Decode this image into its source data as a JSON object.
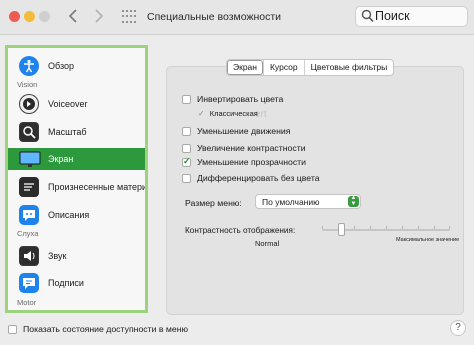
{
  "window": {
    "title": "Специальные возможности"
  },
  "search": {
    "placeholder": "Поиск"
  },
  "sidebar": {
    "items": [
      {
        "label": "Обзор",
        "icon": "overview-icon"
      },
      {
        "label": "Voiceover",
        "icon": "voiceover-icon"
      },
      {
        "label": "Масштаб",
        "icon": "zoom-icon"
      },
      {
        "label": "Экран",
        "icon": "display-icon",
        "active": true
      },
      {
        "label": "Произнесенные материалы",
        "icon": "spoken-content-icon"
      },
      {
        "label": "Описания",
        "icon": "descriptions-icon"
      },
      {
        "label": "Звук",
        "icon": "audio-icon"
      },
      {
        "label": "Подписи",
        "icon": "captions-icon"
      }
    ],
    "sections": {
      "vision": "Vision",
      "hearing": "Слуха",
      "motor": "Motor"
    },
    "active_color": "#2c9a3c",
    "border_color": "#9dd37a"
  },
  "tabs": [
    {
      "label": "Экран",
      "active": true
    },
    {
      "label": "Курсор",
      "active": false
    },
    {
      "label": "Цветовые фильтры",
      "active": false
    }
  ],
  "options": {
    "invert": {
      "label": "Инвертировать цвета",
      "checked": false
    },
    "classic": {
      "label": "Классическая",
      "ghost": "ert"
    },
    "reduce_motion": {
      "label": "Уменьшение движения",
      "checked": false
    },
    "increase_contrast": {
      "label": "Увеличение контрастности",
      "checked": false
    },
    "reduce_transparency": {
      "label": "Уменьшение прозрачности",
      "checked": true
    },
    "differentiate": {
      "label": "Дифференцировать без цвета",
      "checked": false
    }
  },
  "menu_size": {
    "label": "Размер меню:",
    "value": "По умолчанию"
  },
  "contrast": {
    "label": "Контрастность отображения:",
    "min_label": "Normal",
    "max_label": "Максимальное значение",
    "level": 0.13
  },
  "footer": {
    "status_checkbox_label": "Показать состояние доступности в меню",
    "help_label": "?"
  }
}
